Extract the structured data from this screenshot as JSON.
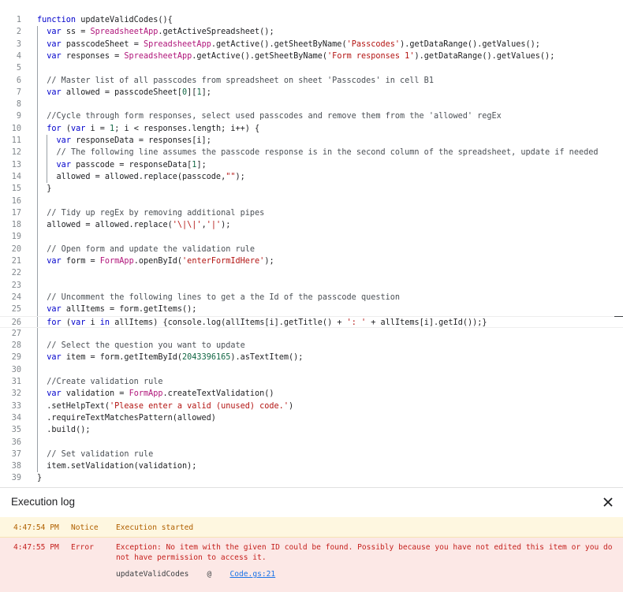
{
  "editor": {
    "lines": [
      [
        [
          "kw",
          "function"
        ],
        [
          "t",
          " updateValidCodes(){"
        ]
      ],
      [
        [
          "t",
          "  "
        ],
        [
          "kw",
          "var"
        ],
        [
          "t",
          " ss = "
        ],
        [
          "cls",
          "SpreadsheetApp"
        ],
        [
          "t",
          ".getActiveSpreadsheet();"
        ]
      ],
      [
        [
          "t",
          "  "
        ],
        [
          "kw",
          "var"
        ],
        [
          "t",
          " passcodeSheet = "
        ],
        [
          "cls",
          "SpreadsheetApp"
        ],
        [
          "t",
          ".getActive().getSheetByName("
        ],
        [
          "str",
          "'Passcodes'"
        ],
        [
          "t",
          ").getDataRange().getValues();"
        ]
      ],
      [
        [
          "t",
          "  "
        ],
        [
          "kw",
          "var"
        ],
        [
          "t",
          " responses = "
        ],
        [
          "cls",
          "SpreadsheetApp"
        ],
        [
          "t",
          ".getActive().getSheetByName("
        ],
        [
          "str",
          "'Form responses 1'"
        ],
        [
          "t",
          ").getDataRange().getValues();"
        ]
      ],
      [],
      [
        [
          "t",
          "  "
        ],
        [
          "cm",
          "// Master list of all passcodes from spreadsheet on sheet 'Passcodes' in cell B1"
        ]
      ],
      [
        [
          "t",
          "  "
        ],
        [
          "kw",
          "var"
        ],
        [
          "t",
          " allowed = passcodeSheet["
        ],
        [
          "num",
          "0"
        ],
        [
          "t",
          "]["
        ],
        [
          "num",
          "1"
        ],
        [
          "t",
          "];"
        ]
      ],
      [],
      [
        [
          "t",
          "  "
        ],
        [
          "cm",
          "//Cycle through form responses, select used passcodes and remove them from the 'allowed' regEx"
        ]
      ],
      [
        [
          "t",
          "  "
        ],
        [
          "kw",
          "for"
        ],
        [
          "t",
          " ("
        ],
        [
          "kw",
          "var"
        ],
        [
          "t",
          " i = "
        ],
        [
          "num",
          "1"
        ],
        [
          "t",
          "; i < responses.length; i++) {"
        ]
      ],
      [
        [
          "t",
          "    "
        ],
        [
          "kw",
          "var"
        ],
        [
          "t",
          " responseData = responses[i];"
        ]
      ],
      [
        [
          "t",
          "    "
        ],
        [
          "cm",
          "// The following line assumes the passcode response is in the second column of the spreadsheet, update if needed"
        ]
      ],
      [
        [
          "t",
          "    "
        ],
        [
          "kw",
          "var"
        ],
        [
          "t",
          " passcode = responseData["
        ],
        [
          "num",
          "1"
        ],
        [
          "t",
          "];"
        ]
      ],
      [
        [
          "t",
          "    allowed = allowed.replace(passcode,"
        ],
        [
          "str",
          "\"\""
        ],
        [
          "t",
          ");"
        ]
      ],
      [
        [
          "t",
          "  }"
        ]
      ],
      [],
      [
        [
          "t",
          "  "
        ],
        [
          "cm",
          "// Tidy up regEx by removing additional pipes"
        ]
      ],
      [
        [
          "t",
          "  allowed = allowed.replace("
        ],
        [
          "str",
          "'\\|\\|'"
        ],
        [
          "t",
          ","
        ],
        [
          "str",
          "'|'"
        ],
        [
          "t",
          ");"
        ]
      ],
      [],
      [
        [
          "t",
          "  "
        ],
        [
          "cm",
          "// Open form and update the validation rule"
        ]
      ],
      [
        [
          "t",
          "  "
        ],
        [
          "kw",
          "var"
        ],
        [
          "t",
          " form = "
        ],
        [
          "cls",
          "FormApp"
        ],
        [
          "t",
          ".openById("
        ],
        [
          "str",
          "'enterFormIdHere'"
        ],
        [
          "t",
          ");"
        ]
      ],
      [],
      [],
      [
        [
          "t",
          "  "
        ],
        [
          "cm",
          "// Uncomment the following lines to get a the Id of the passcode question"
        ]
      ],
      [
        [
          "t",
          "  "
        ],
        [
          "kw",
          "var"
        ],
        [
          "t",
          " allItems = form.getItems();"
        ]
      ],
      [
        [
          "t",
          "  "
        ],
        [
          "kw",
          "for"
        ],
        [
          "t",
          " ("
        ],
        [
          "kw",
          "var"
        ],
        [
          "t",
          " i "
        ],
        [
          "kw",
          "in"
        ],
        [
          "t",
          " allItems) {console.log(allItems[i].getTitle() + "
        ],
        [
          "str",
          "': '"
        ],
        [
          "t",
          " + allItems[i].getId());}"
        ]
      ],
      [],
      [
        [
          "t",
          "  "
        ],
        [
          "cm",
          "// Select the question you want to update"
        ]
      ],
      [
        [
          "t",
          "  "
        ],
        [
          "kw",
          "var"
        ],
        [
          "t",
          " item = form.getItemById("
        ],
        [
          "num",
          "2043396165"
        ],
        [
          "t",
          ").asTextItem();"
        ]
      ],
      [],
      [
        [
          "t",
          "  "
        ],
        [
          "cm",
          "//Create validation rule"
        ]
      ],
      [
        [
          "t",
          "  "
        ],
        [
          "kw",
          "var"
        ],
        [
          "t",
          " validation = "
        ],
        [
          "cls",
          "FormApp"
        ],
        [
          "t",
          ".createTextValidation()"
        ]
      ],
      [
        [
          "t",
          "  .setHelpText("
        ],
        [
          "str",
          "'Please enter a valid (unused) code.'"
        ],
        [
          "t",
          ")"
        ]
      ],
      [
        [
          "t",
          "  .requireTextMatchesPattern(allowed)"
        ]
      ],
      [
        [
          "t",
          "  .build();"
        ]
      ],
      [],
      [
        [
          "t",
          "  "
        ],
        [
          "cm",
          "// Set validation rule"
        ]
      ],
      [
        [
          "t",
          "  item.setValidation(validation);"
        ]
      ],
      [
        [
          "t",
          "}"
        ]
      ]
    ]
  },
  "log": {
    "title": "Execution log",
    "close_icon": "close-icon",
    "entries": [
      {
        "time": "4:47:54 PM",
        "level": "Notice",
        "message": "Execution started"
      },
      {
        "time": "4:47:55 PM",
        "level": "Error",
        "message": "Exception: No item with the given ID could be found. Possibly because you have not edited this item or you do not have permission to access it.",
        "stack_fn": "updateValidCodes",
        "stack_at": "@",
        "stack_link": "Code.gs:21"
      }
    ]
  },
  "colors": {
    "keyword": "#0000cc",
    "class": "#b0157a",
    "string": "#b31412",
    "number": "#116644",
    "notice_bg": "#fef7e0",
    "error_bg": "#fce8e6",
    "link": "#1a73e8"
  }
}
